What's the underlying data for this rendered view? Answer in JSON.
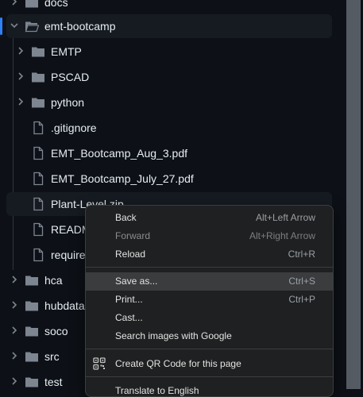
{
  "tree": {
    "items": [
      {
        "label": "docs",
        "type": "folder"
      },
      {
        "label": "emt-bootcamp",
        "type": "folder",
        "expanded": true
      },
      {
        "label": "EMTP",
        "type": "folder"
      },
      {
        "label": "PSCAD",
        "type": "folder"
      },
      {
        "label": "python",
        "type": "folder"
      },
      {
        "label": ".gitignore",
        "type": "file"
      },
      {
        "label": "EMT_Bootcamp_Aug_3.pdf",
        "type": "file"
      },
      {
        "label": "EMT_Bootcamp_July_27.pdf",
        "type": "file"
      },
      {
        "label": "Plant-Level.zip",
        "type": "file"
      },
      {
        "label": "READM",
        "type": "file"
      },
      {
        "label": "require",
        "type": "file"
      },
      {
        "label": "hca",
        "type": "folder"
      },
      {
        "label": "hubdata",
        "type": "folder"
      },
      {
        "label": "soco",
        "type": "folder"
      },
      {
        "label": "src",
        "type": "folder"
      },
      {
        "label": "test",
        "type": "folder"
      }
    ]
  },
  "context_menu": {
    "items": [
      {
        "label": "Back",
        "shortcut": "Alt+Left Arrow"
      },
      {
        "label": "Forward",
        "shortcut": "Alt+Right Arrow"
      },
      {
        "label": "Reload",
        "shortcut": "Ctrl+R"
      },
      {
        "label": "Save as...",
        "shortcut": "Ctrl+S"
      },
      {
        "label": "Print...",
        "shortcut": "Ctrl+P"
      },
      {
        "label": "Cast..."
      },
      {
        "label": "Search images with Google"
      },
      {
        "label": "Create QR Code for this page"
      },
      {
        "label": "Translate to English"
      }
    ]
  },
  "colors": {
    "background": "#0d1117",
    "accent": "#2f81f7",
    "icon": "#7d8590",
    "menu_background": "#1f2021"
  }
}
